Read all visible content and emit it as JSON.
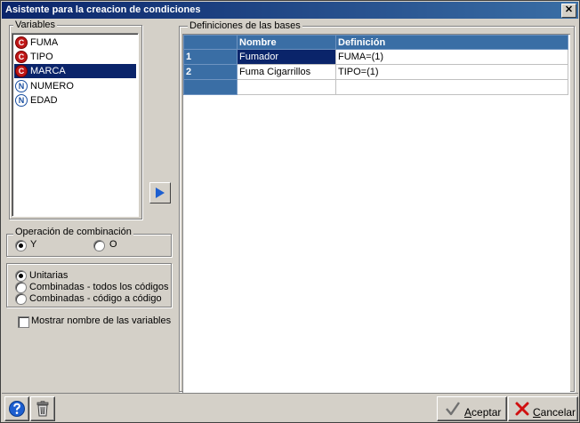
{
  "window": {
    "title": "Asistente para la creacion de condiciones",
    "close_glyph": "✕"
  },
  "variables": {
    "legend": "Variables",
    "items": [
      {
        "label": "FUMA",
        "type_letter": "C",
        "icon": "categorical-variable-icon",
        "selected": false
      },
      {
        "label": "TIPO",
        "type_letter": "C",
        "icon": "categorical-variable-icon",
        "selected": false
      },
      {
        "label": "MARCA",
        "type_letter": "C",
        "icon": "categorical-variable-icon",
        "selected": true
      },
      {
        "label": "NUMERO",
        "type_letter": "N",
        "icon": "numeric-variable-icon",
        "selected": false
      },
      {
        "label": "EDAD",
        "type_letter": "N",
        "icon": "numeric-variable-icon",
        "selected": false
      }
    ]
  },
  "combination": {
    "legend": "Operación de combinación",
    "option_y": "Y",
    "option_o": "O",
    "selected": "Y"
  },
  "mode": {
    "options": [
      "Unitarias",
      "Combinadas - todos los códigos",
      "Combinadas - código a código"
    ],
    "selected": "Unitarias"
  },
  "show_names": {
    "label": "Mostrar nombre de las variables",
    "checked": false
  },
  "definitions": {
    "legend": "Definiciones de las bases",
    "columns": [
      "Nombre",
      "Definición"
    ],
    "rows": [
      {
        "num": "1",
        "nombre": "Fumador",
        "definicion": "FUMA=(1)"
      },
      {
        "num": "2",
        "nombre": "Fuma Cigarrillos",
        "definicion": "TIPO=(1)"
      }
    ]
  },
  "buttons": {
    "accept_rest": "ceptar",
    "accept_mnemonic": "A",
    "cancel_rest": "ancelar",
    "cancel_mnemonic": "C"
  },
  "colors": {
    "title_start": "#0a246a",
    "title_end": "#3a6ea5",
    "grid_header": "#3a6ea5",
    "selection": "#0a246a"
  }
}
